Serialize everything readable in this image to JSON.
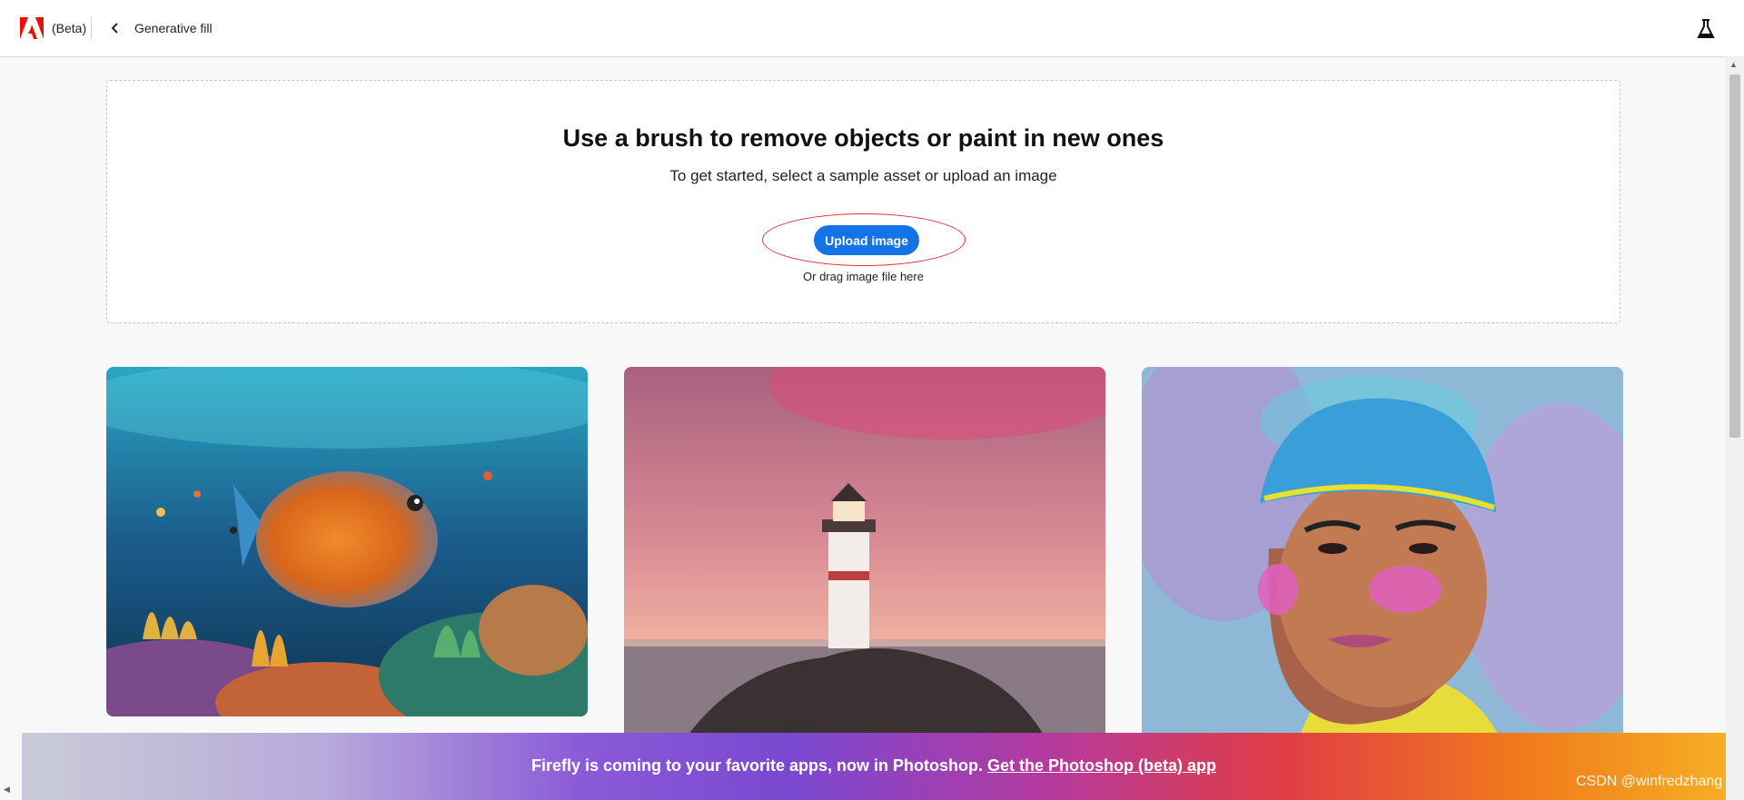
{
  "header": {
    "beta_label": "(Beta)",
    "page_title": "Generative fill"
  },
  "dropzone": {
    "title": "Use a brush to remove objects or paint in new ones",
    "subtitle": "To get started, select a sample asset or upload an image",
    "upload_button": "Upload image",
    "drag_hint": "Or drag image file here"
  },
  "samples": [
    {
      "subject": "underwater coral reef with fish"
    },
    {
      "subject": "lighthouse on rocks at sunset"
    },
    {
      "subject": "illustrated portrait of man in beanie"
    }
  ],
  "banner": {
    "text": "Firefly is coming to your favorite apps, now in Photoshop.",
    "link": "Get the Photoshop (beta) app"
  },
  "watermark": "CSDN @winfredzhang",
  "colors": {
    "accent": "#1473e6",
    "adobe_red": "#eb1000",
    "highlight_ring": "#e0303a"
  },
  "icons": {
    "logo": "adobe-logo-icon",
    "back": "chevron-left-icon",
    "labs": "flask-icon"
  }
}
